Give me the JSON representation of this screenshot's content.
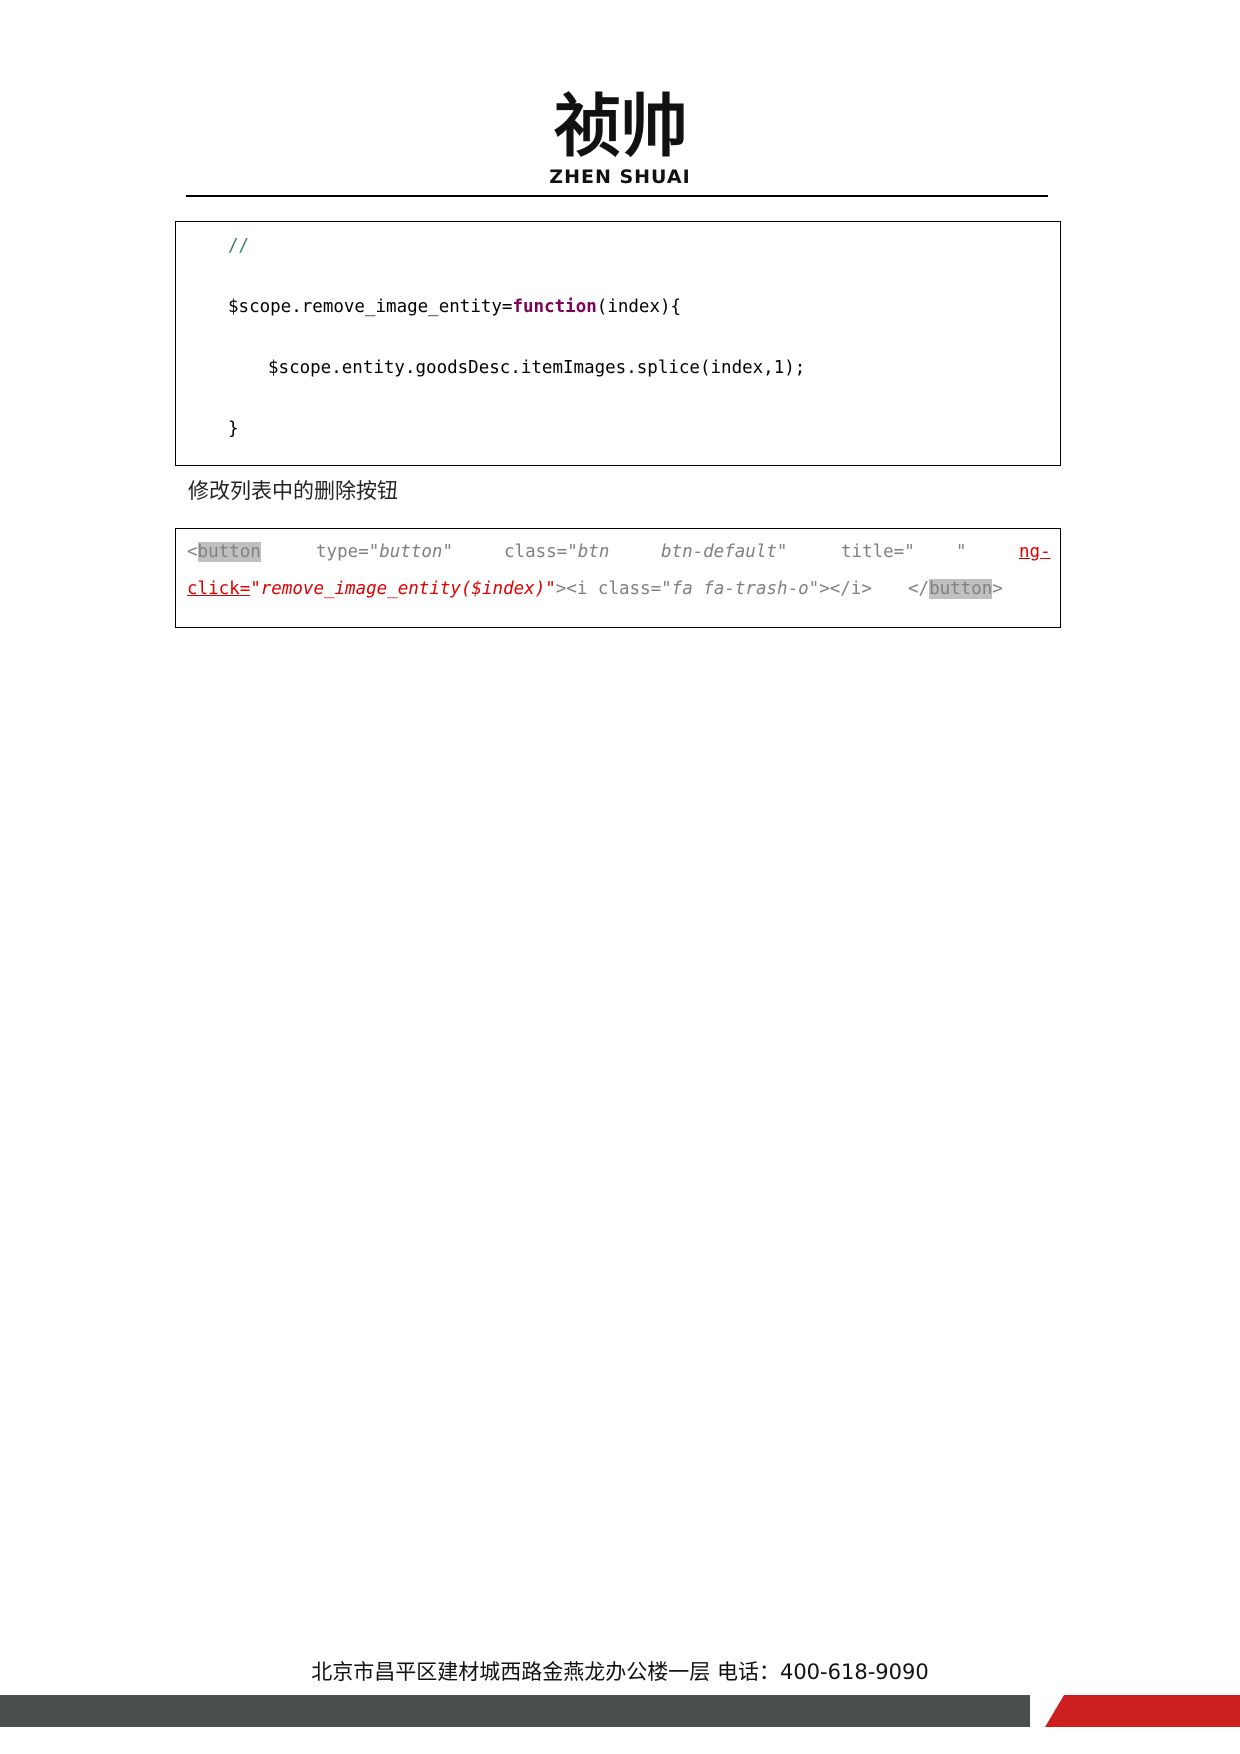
{
  "header": {
    "logo_cn": "祯帅",
    "logo_en": "ZHEN SHUAI"
  },
  "js_code": {
    "comment": "//",
    "line1_pre": "$scope.remove_image_entity=",
    "line1_kw": "function",
    "line1_post": "(index){",
    "line2": "$scope.entity.goodsDesc.itemImages.splice(index,1);",
    "line3": "}"
  },
  "caption": "修改列表中的删除按钮",
  "html_code": {
    "open_lt": "<",
    "open_tag": "button",
    "type_attr": "type=",
    "type_val": "\"button\"",
    "class_attr": "class=",
    "class_val1": "\"btn",
    "class_val2": "btn-default\"",
    "title_attr": "title=",
    "title_val_open": "\"",
    "title_val_close": "\"",
    "ng_part1": "ng-",
    "ng_part2": "click",
    "ng_eq": "=",
    "ng_val": "\"remove_image_entity($index)\"",
    "inner_i_open": "><i class=",
    "inner_i_val": "\"fa fa-trash-o\"",
    "inner_i_close": "></i>",
    "close_lt": "</",
    "close_tag": "button",
    "close_gt": ">"
  },
  "footer": {
    "address": "北京市昌平区建材城西路金燕龙办公楼一层   电话：400-618-9090",
    "bar_colors": {
      "gray": "#4a4f4f",
      "red": "#cc1f1f"
    }
  }
}
